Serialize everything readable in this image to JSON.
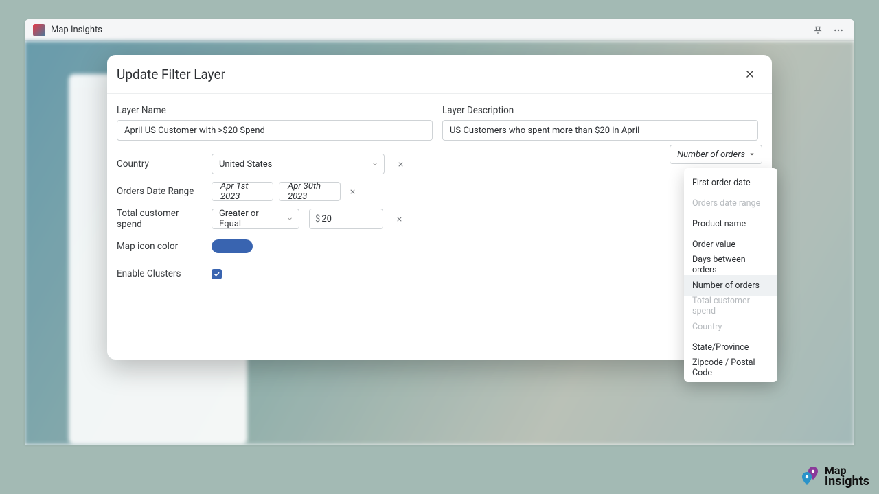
{
  "header": {
    "title": "Map Insights"
  },
  "modal": {
    "title": "Update Filter Layer",
    "layerName": {
      "label": "Layer Name",
      "value": "April US Customer with >$20 Spend"
    },
    "layerDesc": {
      "label": "Layer Description",
      "value": "US Customers who spent more than $20 in April"
    },
    "filters": {
      "country": {
        "label": "Country",
        "value": "United States"
      },
      "dateRange": {
        "label": "Orders Date Range",
        "start": "Apr 1st 2023",
        "end": "Apr 30th 2023"
      },
      "spend": {
        "label": "Total customer spend",
        "operator": "Greater or Equal",
        "prefix": "$",
        "amount": "20"
      },
      "iconColor": {
        "label": "Map icon color",
        "hex": "#3964b0"
      },
      "clusters": {
        "label": "Enable Clusters",
        "checked": true
      }
    },
    "addFilter": {
      "button": "Number of orders",
      "options": [
        {
          "label": "First order date",
          "disabled": false
        },
        {
          "label": "Orders date range",
          "disabled": true
        },
        {
          "label": "Product name",
          "disabled": false
        },
        {
          "label": "Order value",
          "disabled": false
        },
        {
          "label": "Days between orders",
          "disabled": false
        },
        {
          "label": "Number of orders",
          "disabled": false,
          "hover": true
        },
        {
          "label": "Total customer spend",
          "disabled": true
        },
        {
          "label": "Country",
          "disabled": true
        },
        {
          "label": "State/Province",
          "disabled": false
        },
        {
          "label": "Zipcode / Postal Code",
          "disabled": false
        }
      ]
    }
  },
  "brand": {
    "line1": "Map",
    "line2": "Insights"
  }
}
